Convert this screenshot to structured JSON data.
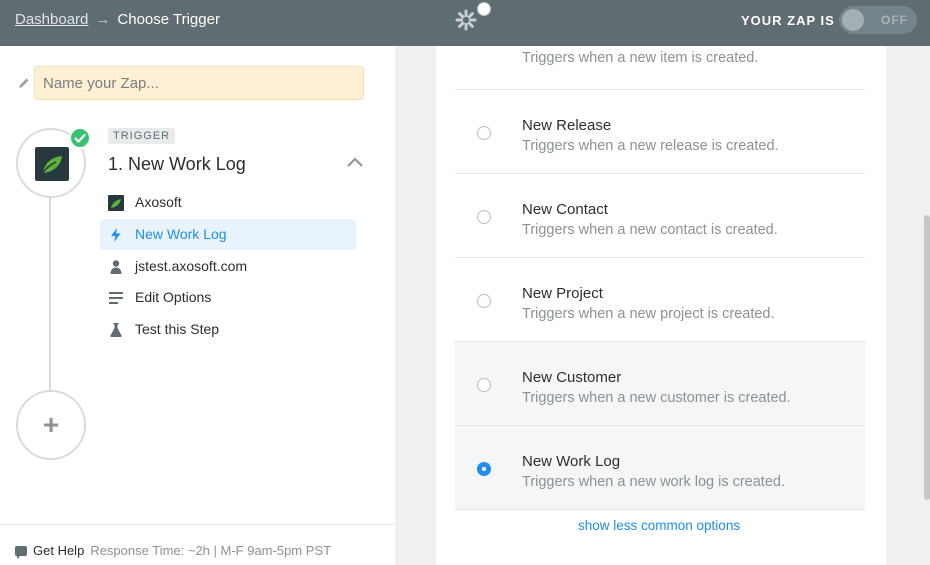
{
  "header": {
    "breadcrumb_link": "Dashboard",
    "breadcrumb_arrow": "→",
    "breadcrumb_current": "Choose Trigger",
    "logo_icon": "zapier-asterisk-icon",
    "zap_status_label": "YOUR ZAP IS",
    "toggle_text": "OFF"
  },
  "sidebar": {
    "zap_name_placeholder": "Name your Zap...",
    "zap_name_value": "",
    "step": {
      "badge": "TRIGGER",
      "title": "1. New Work Log",
      "completed": true
    },
    "menu": [
      {
        "label": "Axosoft",
        "icon": "axosoft-app-icon",
        "active": false
      },
      {
        "label": "New Work Log",
        "icon": "lightning-bolt-icon",
        "active": true
      },
      {
        "label": "jstest.axosoft.com",
        "icon": "user-icon",
        "active": false
      },
      {
        "label": "Edit Options",
        "icon": "lines-icon",
        "active": false
      },
      {
        "label": "Test this Step",
        "icon": "flask-icon",
        "active": false
      }
    ],
    "add_step_symbol": "+",
    "help": {
      "label": "Get Help",
      "text": "Response Time: ~2h | M-F 9am-5pm PST"
    }
  },
  "options": [
    {
      "title": "",
      "desc": "Triggers when a new item is created.",
      "selected": false
    },
    {
      "title": "New Release",
      "desc": "Triggers when a new release is created.",
      "selected": false
    },
    {
      "title": "New Contact",
      "desc": "Triggers when a new contact is created.",
      "selected": false
    },
    {
      "title": "New Project",
      "desc": "Triggers when a new project is created.",
      "selected": false
    },
    {
      "title": "New Customer",
      "desc": "Triggers when a new customer is created.",
      "selected": false
    },
    {
      "title": "New Work Log",
      "desc": "Triggers when a new work log is created.",
      "selected": true
    }
  ],
  "show_less_link": "show less common options",
  "colors": {
    "header_bg": "#5f6c72",
    "accent": "#1f8ded",
    "success": "#38c172",
    "zap_name_bg": "#fdf0d4"
  }
}
